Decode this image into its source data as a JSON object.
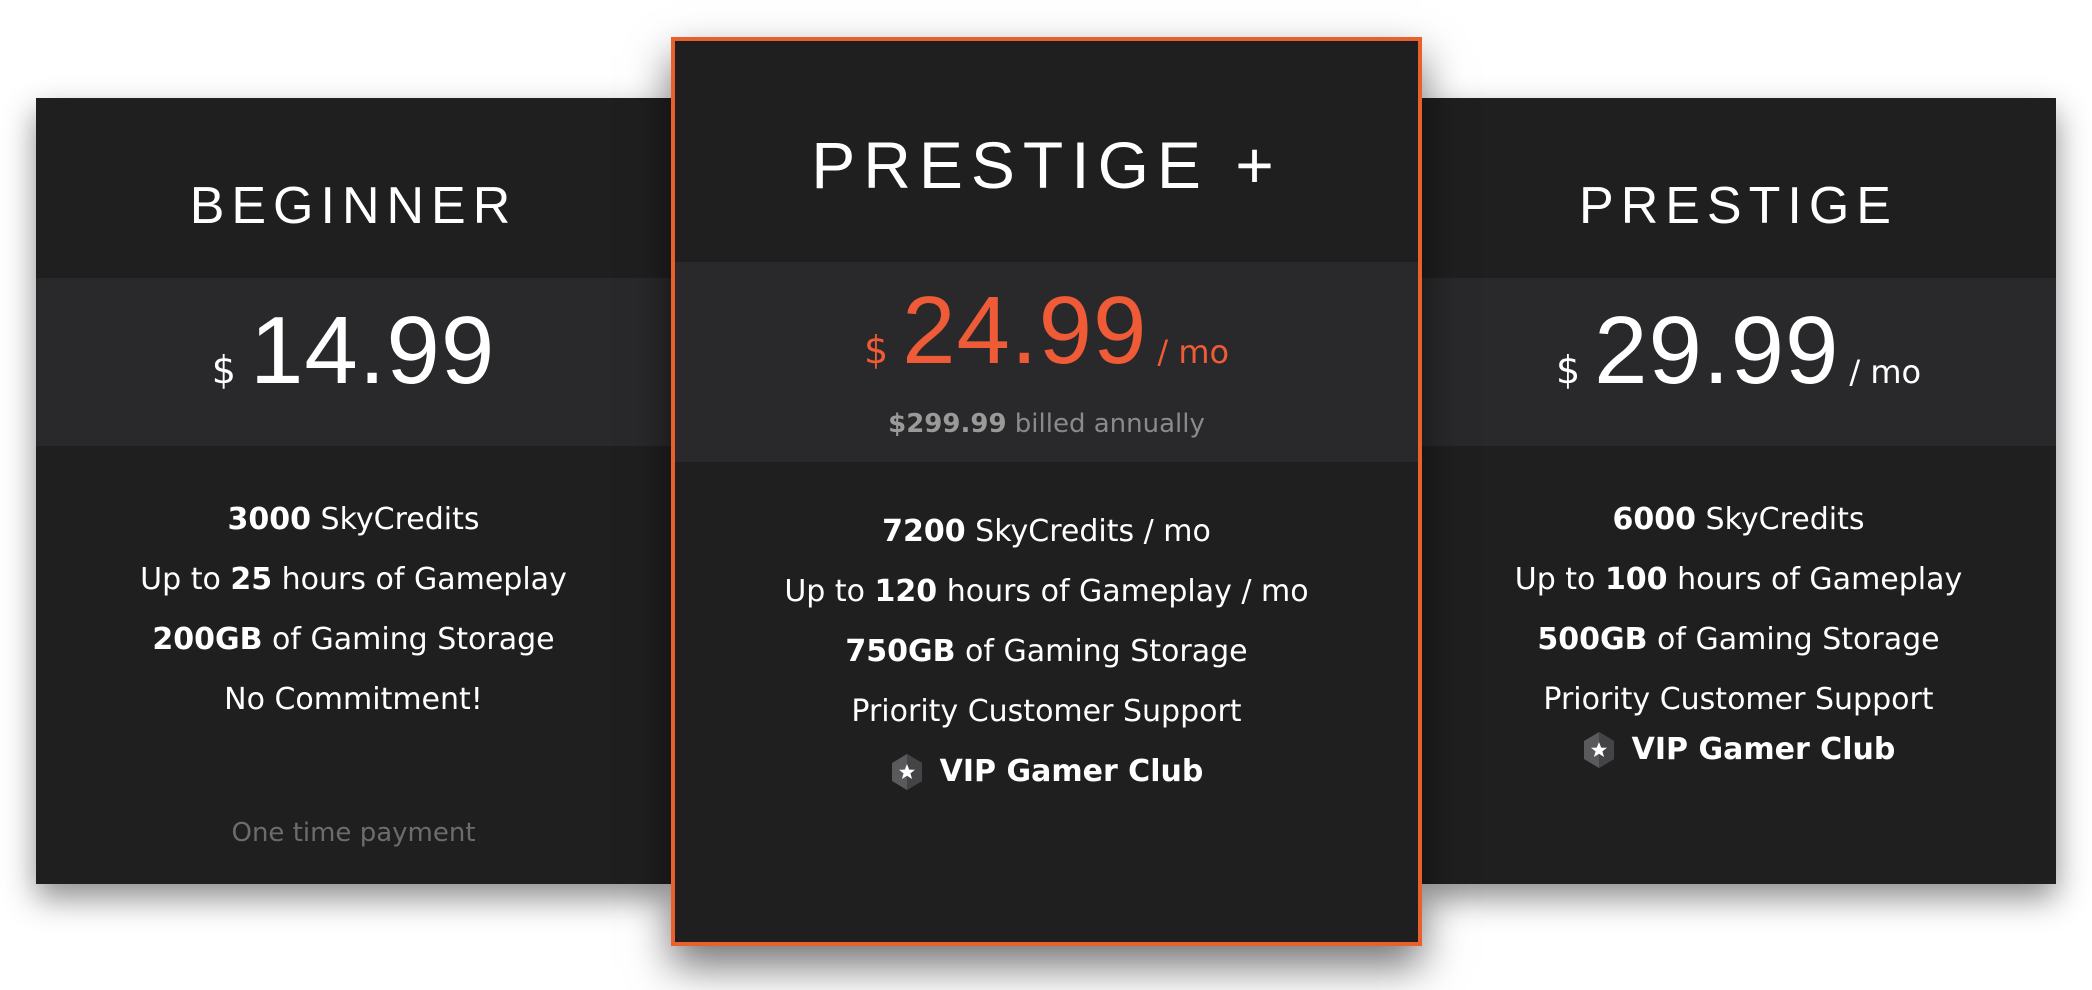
{
  "plans": [
    {
      "name": "BEGINNER",
      "currency": "$",
      "amount": "14.99",
      "per": "",
      "features": [
        {
          "bold": "3000",
          "text": " SkyCredits",
          "prefix": ""
        },
        {
          "prefix": "Up to ",
          "bold": "25",
          "text": " hours of Gameplay"
        },
        {
          "bold": "200GB",
          "text": " of Gaming Storage",
          "prefix": ""
        },
        {
          "prefix": "No Commitment!",
          "bold": "",
          "text": ""
        }
      ],
      "footnote": "One time payment"
    },
    {
      "name": "PRESTIGE +",
      "currency": "$",
      "amount": "24.99",
      "per": "/ mo",
      "billed_amount": "$299.99",
      "billed_text": " billed annually",
      "features": [
        {
          "bold": "7200",
          "text": " SkyCredits / mo",
          "prefix": ""
        },
        {
          "prefix": "Up to ",
          "bold": "120",
          "text": " hours of Gameplay / mo"
        },
        {
          "bold": "750GB",
          "text": " of Gaming Storage",
          "prefix": ""
        },
        {
          "prefix": "Priority Customer Support",
          "bold": "",
          "text": ""
        }
      ],
      "vip": "VIP Gamer Club"
    },
    {
      "name": "PRESTIGE",
      "currency": "$",
      "amount": "29.99",
      "per": "/ mo",
      "features": [
        {
          "bold": "6000",
          "text": " SkyCredits",
          "prefix": ""
        },
        {
          "prefix": "Up to ",
          "bold": "100",
          "text": " hours of Gameplay"
        },
        {
          "bold": "500GB",
          "text": " of Gaming Storage",
          "prefix": ""
        },
        {
          "prefix": "Priority Customer Support",
          "bold": "",
          "text": ""
        }
      ],
      "vip": "VIP Gamer Club"
    }
  ],
  "colors": {
    "accent": "#ef5a37",
    "card_bg": "#1f1f20",
    "price_band_bg": "#29292b",
    "muted_text": "#6c6c6c"
  },
  "icons": {
    "vip": "hexagon-star-icon"
  }
}
